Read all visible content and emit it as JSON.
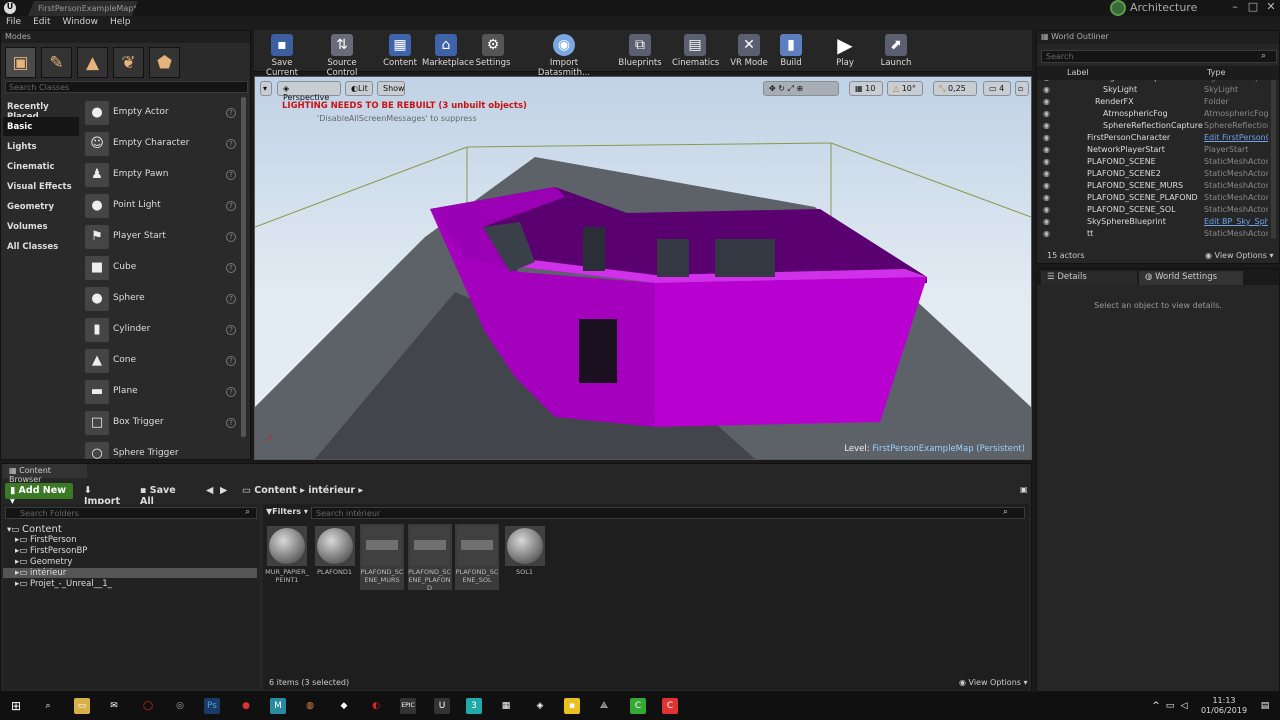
{
  "window": {
    "doc_tab": "FirstPersonExampleMap*",
    "project_badge": "Architecture",
    "menu": [
      "File",
      "Edit",
      "Window",
      "Help"
    ]
  },
  "modes": {
    "tab": "Modes",
    "search_placeholder": "Search Classes",
    "categories": [
      "Recently Placed",
      "Basic",
      "Lights",
      "Cinematic",
      "Visual Effects",
      "Geometry",
      "Volumes",
      "All Classes"
    ],
    "items": [
      {
        "label": "Empty Actor",
        "icon": "sphere"
      },
      {
        "label": "Empty Character",
        "icon": "person"
      },
      {
        "label": "Empty Pawn",
        "icon": "pawn"
      },
      {
        "label": "Point Light",
        "icon": "bulb"
      },
      {
        "label": "Player Start",
        "icon": "flag"
      },
      {
        "label": "Cube",
        "icon": "cube"
      },
      {
        "label": "Sphere",
        "icon": "sphere"
      },
      {
        "label": "Cylinder",
        "icon": "cylinder"
      },
      {
        "label": "Cone",
        "icon": "cone"
      },
      {
        "label": "Plane",
        "icon": "plane"
      },
      {
        "label": "Box Trigger",
        "icon": "box"
      },
      {
        "label": "Sphere Trigger",
        "icon": "sphere"
      }
    ]
  },
  "toolbar": [
    "Save Current",
    "Source Control",
    "Content",
    "Marketplace",
    "Settings",
    "Import Datasmith...",
    "Blueprints",
    "Cinematics",
    "VR Mode",
    "Build",
    "Play",
    "Launch"
  ],
  "viewport": {
    "perspective": "Perspective",
    "lit": "Lit",
    "show": "Show",
    "warning": "LIGHTING NEEDS TO BE REBUILT (3 unbuilt objects)",
    "suppress": "'DisableAllScreenMessages' to suppress",
    "level_label": "Level:",
    "level_name": "FirstPersonExampleMap (Persistent)",
    "snap_angle": "10",
    "rot_snap": "10°",
    "scale_snap": "0,25",
    "cam_speed": "4"
  },
  "outliner": {
    "tab": "World Outliner",
    "search_placeholder": "Search",
    "col_label": "Label",
    "col_type": "Type",
    "rows": [
      {
        "name": "LightmassImportanceVolume",
        "type": "LightmassImportanceVolume",
        "link": false,
        "indent": 2
      },
      {
        "name": "SkyLight",
        "type": "SkyLight",
        "link": false,
        "indent": 2
      },
      {
        "name": "RenderFX",
        "type": "Folder",
        "link": false,
        "indent": 1
      },
      {
        "name": "AtmosphericFog",
        "type": "AtmosphericFog",
        "link": false,
        "indent": 2
      },
      {
        "name": "SphereReflectionCapture",
        "type": "SphereReflectionCapture",
        "link": false,
        "indent": 2
      },
      {
        "name": "FirstPersonCharacter",
        "type": "Edit FirstPersonCharacter",
        "link": true,
        "indent": 0
      },
      {
        "name": "NetworkPlayerStart",
        "type": "PlayerStart",
        "link": false,
        "indent": 0
      },
      {
        "name": "PLAFOND_SCENE",
        "type": "StaticMeshActor",
        "link": false,
        "indent": 0
      },
      {
        "name": "PLAFOND_SCENE2",
        "type": "StaticMeshActor",
        "link": false,
        "indent": 0
      },
      {
        "name": "PLAFOND_SCENE_MURS",
        "type": "StaticMeshActor",
        "link": false,
        "indent": 0
      },
      {
        "name": "PLAFOND_SCENE_PLAFOND",
        "type": "StaticMeshActor",
        "link": false,
        "indent": 0
      },
      {
        "name": "PLAFOND_SCENE_SOL",
        "type": "StaticMeshActor",
        "link": false,
        "indent": 0
      },
      {
        "name": "SkySphereBlueprint",
        "type": "Edit BP_Sky_Sphere",
        "link": true,
        "indent": 0
      },
      {
        "name": "tt",
        "type": "StaticMeshActor",
        "link": false,
        "indent": 0
      }
    ],
    "count": "15 actors",
    "view_options": "View Options"
  },
  "details": {
    "tab1": "Details",
    "tab2": "World Settings",
    "empty_msg": "Select an object to view details."
  },
  "content_browser": {
    "tab": "Content Browser",
    "add_new": "Add New",
    "import": "Import",
    "save_all": "Save All",
    "path_root": "Content",
    "path_leaf": "intérieur",
    "folder_search": "Search Folders",
    "asset_search": "Search intérieur",
    "filters": "Filters",
    "tree": [
      {
        "label": "Content",
        "depth": 0
      },
      {
        "label": "FirstPerson",
        "depth": 1
      },
      {
        "label": "FirstPersonBP",
        "depth": 1
      },
      {
        "label": "Geometry",
        "depth": 1
      },
      {
        "label": "intérieur",
        "depth": 1
      },
      {
        "label": "Projet_-_Unreal__1_",
        "depth": 1
      }
    ],
    "assets": [
      {
        "label": "MUR_PAPIER_PEINT1",
        "kind": "material",
        "selected": false
      },
      {
        "label": "PLAFOND1",
        "kind": "material",
        "selected": false
      },
      {
        "label": "PLAFOND_SCENE_MURS",
        "kind": "mesh",
        "selected": true
      },
      {
        "label": "PLAFOND_SCENE_PLAFOND",
        "kind": "mesh",
        "selected": true
      },
      {
        "label": "PLAFOND_SCENE_SOL",
        "kind": "mesh",
        "selected": true
      },
      {
        "label": "SOL1",
        "kind": "material",
        "selected": false
      }
    ],
    "status": "6 items (3 selected)",
    "view_options": "View Options"
  },
  "taskbar": {
    "time": "11:13",
    "date": "01/06/2019"
  },
  "colors": {
    "accent_green": "#3a7a25",
    "walls": "#b000c8",
    "warning": "#cc1111"
  }
}
